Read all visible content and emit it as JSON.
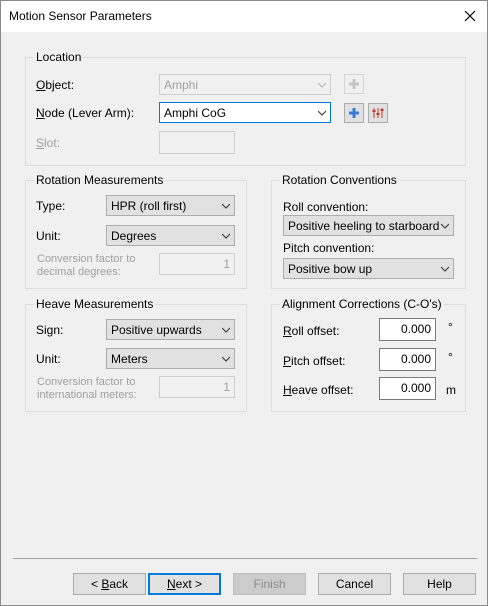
{
  "window": {
    "title": "Motion Sensor Parameters"
  },
  "location": {
    "title": "Location",
    "object_label": "Object:",
    "object_value": "Amphi",
    "node_label": "Node (Lever Arm):",
    "node_value": "Amphi CoG",
    "slot_label": "Slot:",
    "slot_value": ""
  },
  "rotation_measurements": {
    "title": "Rotation Measurements",
    "type_label": "Type:",
    "type_value": "HPR (roll first)",
    "unit_label": "Unit:",
    "unit_value": "Degrees",
    "conv_label": "Conversion factor to decimal degrees:",
    "conv_value": "1"
  },
  "rotation_conventions": {
    "title": "Rotation Conventions",
    "roll_label": "Roll convention:",
    "roll_value": "Positive heeling to starboard",
    "pitch_label": "Pitch convention:",
    "pitch_value": "Positive bow up"
  },
  "heave_measurements": {
    "title": "Heave Measurements",
    "sign_label": "Sign:",
    "sign_value": "Positive upwards",
    "unit_label": "Unit:",
    "unit_value": "Meters",
    "conv_label": "Conversion factor to international meters:",
    "conv_value": "1"
  },
  "alignment": {
    "title": "Alignment Corrections (C-O's)",
    "roll_label": "Roll offset:",
    "roll_value": "0.000",
    "roll_unit": "°",
    "pitch_label": "Pitch offset:",
    "pitch_value": "0.000",
    "pitch_unit": "°",
    "heave_label": "Heave offset:",
    "heave_value": "0.000",
    "heave_unit": "m"
  },
  "buttons": {
    "back": "< Back",
    "next": "Next >",
    "finish": "Finish",
    "cancel": "Cancel",
    "help": "Help"
  },
  "icons": {
    "close": "close-icon",
    "add": "plus-icon",
    "sliders": "sliders-icon",
    "dropdown": "chevron-down-icon"
  },
  "colors": {
    "focus": "#0078d7",
    "accent_icon": "#3a7bd5",
    "sliders_icon": "#c0392b"
  }
}
